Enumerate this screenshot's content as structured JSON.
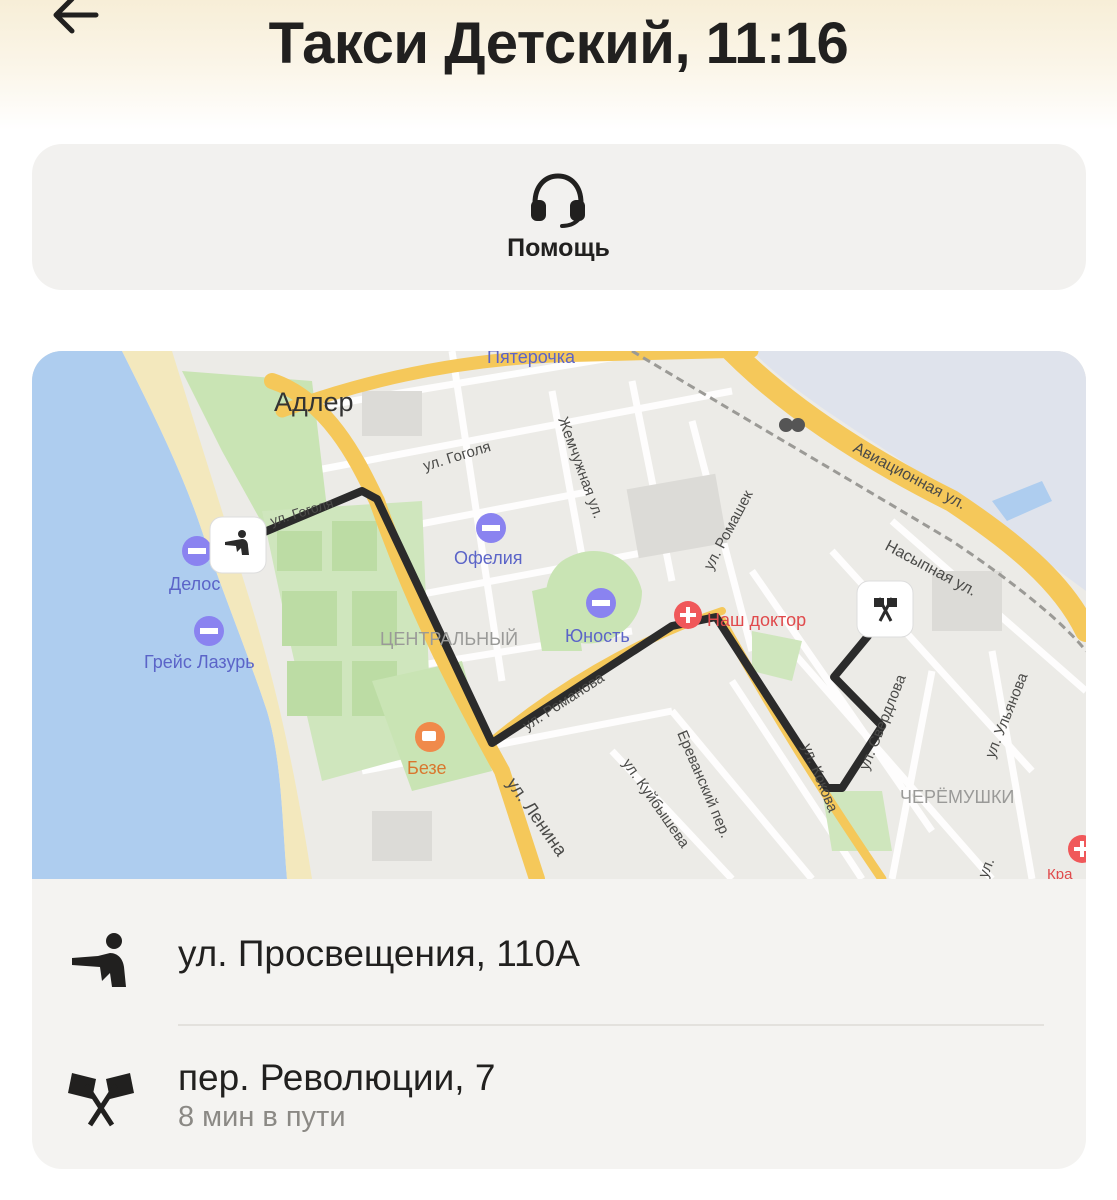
{
  "header": {
    "title": "Такси Детский, 11:16",
    "back_icon": "arrow-left-icon"
  },
  "help": {
    "label": "Помощь",
    "icon": "headset-icon"
  },
  "map": {
    "labels": {
      "city": "Адлер",
      "pyaterochka": "Пятерочка",
      "gogolya_1": "ул. Гоголя",
      "gogolya_2": "ул. Гоголя",
      "zhemchuzhnaya": "Жемчужная ул.",
      "aviatsionnaya": "Авиационная ул.",
      "nasypnaya": "Насыпная ул.",
      "romashek": "ул. Ромашек",
      "ofelia": "Офелия",
      "delos": "Делос",
      "greis": "Грейс Лазурь",
      "tsentralny": "ЦЕНТРАЛЬНЫЙ",
      "yunost": "Юность",
      "nash_doktor": "Наш доктор",
      "beze": "Безе",
      "romanova": "ул. Романова",
      "kuibysheva": "ул. Куйбышева",
      "erevansky": "Ереванский пер.",
      "lenina": "ул. Ленина",
      "kolokova": "ул. Кокова",
      "sverdlova": "ул. Свердлова",
      "ulyanova": "ул. Ульянова",
      "cheryomushki": "ЧЕРЁМУШКИ",
      "misc_ul": "ул.",
      "kra": "Кра"
    },
    "colors": {
      "route": "#2b2b2b",
      "water": "#aecdef",
      "park": "#c9e4b4",
      "road": "#f5c85a",
      "poi": "#8a83f0",
      "cafe": "#f08a4b",
      "medical": "#f0585a"
    }
  },
  "route": {
    "pickup": {
      "address": "ул. Просвещения, 110А",
      "icon": "pickup-person-icon"
    },
    "destination": {
      "address": "пер. Революции, 7",
      "duration": "8 мин в пути",
      "icon": "finish-flags-icon"
    }
  }
}
